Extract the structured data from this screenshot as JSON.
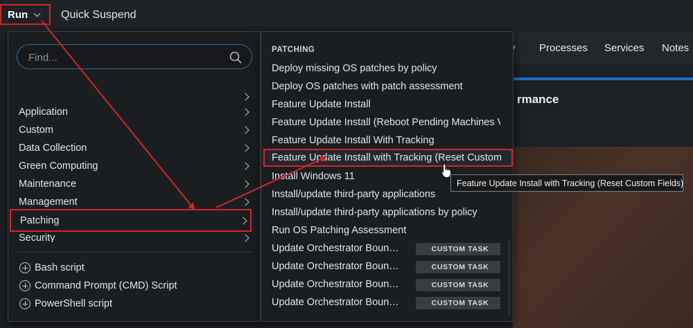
{
  "topbar": {
    "run_label": "Run",
    "quick_suspend_label": "Quick Suspend"
  },
  "background": {
    "tabs": [
      "y",
      "Processes",
      "Services",
      "Notes"
    ],
    "section_title": "rmance"
  },
  "left_menu": {
    "search_placeholder": "Find...",
    "categories": [
      {
        "label": ""
      },
      {
        "label": "Application"
      },
      {
        "label": "Custom"
      },
      {
        "label": "Data Collection"
      },
      {
        "label": "Green Computing"
      },
      {
        "label": "Maintenance"
      },
      {
        "label": "Management"
      },
      {
        "label": "Patching"
      },
      {
        "label": "Security"
      }
    ],
    "scripts": [
      {
        "label": "Bash script"
      },
      {
        "label": "Command Prompt (CMD) Script"
      },
      {
        "label": "PowerShell script"
      }
    ]
  },
  "right_menu": {
    "heading": "PATCHING",
    "items": [
      {
        "label": "Deploy missing OS patches by policy"
      },
      {
        "label": "Deploy OS patches with patch assessment"
      },
      {
        "label": "Feature Update Install"
      },
      {
        "label": "Feature Update Install (Reboot Pending Machines Va"
      },
      {
        "label": "Feature Update Install With Tracking"
      },
      {
        "label": "Feature Update Install with Tracking (Reset Custom"
      },
      {
        "label": "Install Windows 11"
      },
      {
        "label": "Install/update third-party applications"
      },
      {
        "label": "Install/update third-party applications by policy"
      },
      {
        "label": "Run OS Patching Assessment"
      }
    ],
    "custom_items": [
      {
        "label": "Update Orchestrator Bouncer",
        "badge": "CUSTOM TASK"
      },
      {
        "label": "Update Orchestrator Bouncer",
        "badge": "CUSTOM TASK"
      },
      {
        "label": "Update Orchestrator Bouncer",
        "badge": "CUSTOM TASK"
      },
      {
        "label": "Update Orchestrator Bouncer",
        "badge": "CUSTOM TASK"
      }
    ]
  },
  "tooltip": {
    "text": "Feature Update Install with Tracking (Reset Custom Fields)"
  },
  "colors": {
    "highlight_border": "#d0262a",
    "accent_blue": "#1e6fd0",
    "menu_bg": "#1b1e21"
  }
}
